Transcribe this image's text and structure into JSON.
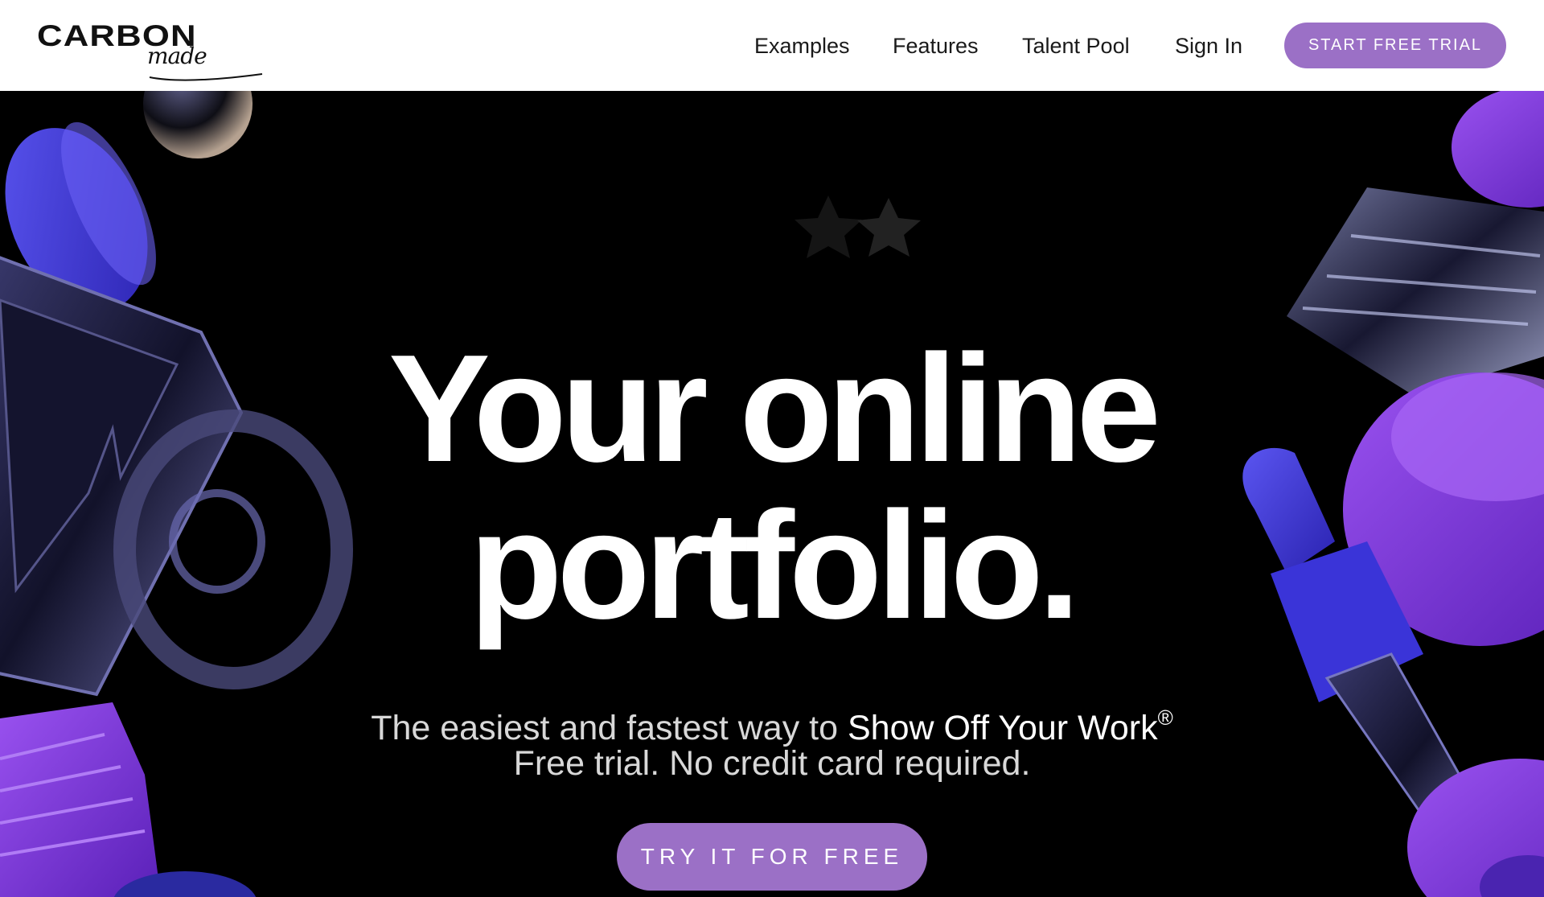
{
  "brand": {
    "wordmark": "CARBON",
    "script": "made"
  },
  "nav": {
    "items": [
      {
        "label": "Examples"
      },
      {
        "label": "Features"
      },
      {
        "label": "Talent Pool"
      },
      {
        "label": "Sign In"
      }
    ],
    "cta_label": "START FREE TRIAL"
  },
  "hero": {
    "headline_line1": "Your online",
    "headline_line2": "portfolio.",
    "subline_prefix": "The easiest and fastest way to ",
    "subline_emphasis": "Show Off Your Work",
    "subline_mark": "®",
    "subline_2": "Free trial. No credit card required.",
    "cta_label": "TRY IT FOR FREE"
  },
  "colors": {
    "accent_purple": "#9b70c6",
    "hero_background": "#000000",
    "header_background": "#ffffff",
    "shape_violet": "#7a35e0",
    "shape_blue": "#3d36d8"
  }
}
